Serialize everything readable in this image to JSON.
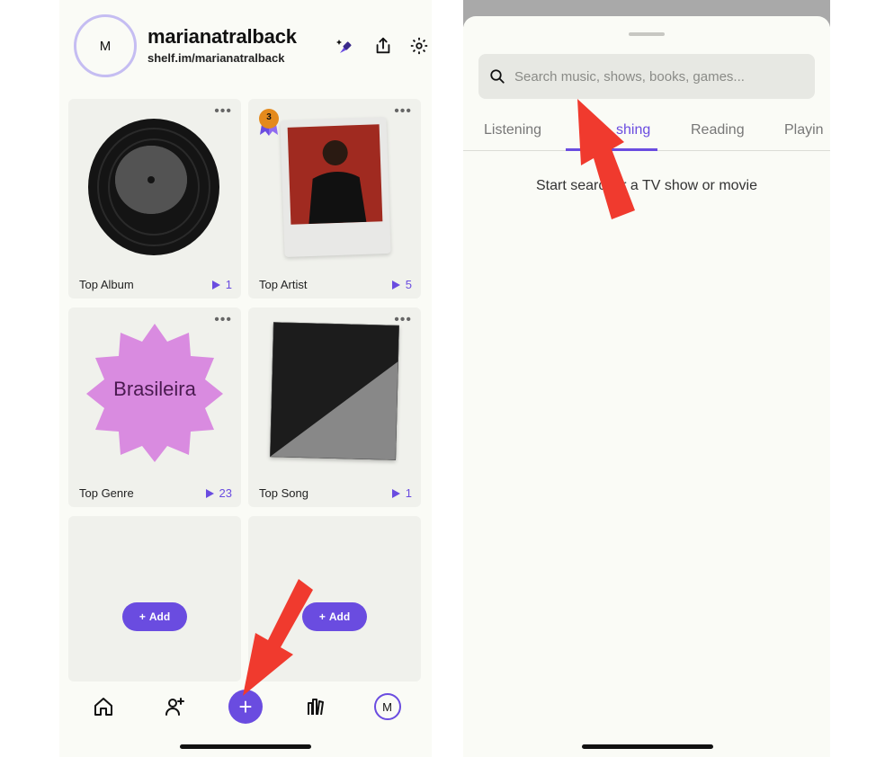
{
  "profile": {
    "avatar_initial": "M",
    "username": "marianatralback",
    "link": "shelf.im/marianatralback"
  },
  "cards": [
    {
      "label": "Top Album",
      "count": "1"
    },
    {
      "label": "Top Artist",
      "count": "5",
      "badge": "3"
    },
    {
      "label": "Top Genre",
      "count": "23",
      "genre_text": "Brasileira"
    },
    {
      "label": "Top Song",
      "count": "1"
    },
    {
      "add_label": "Add"
    },
    {
      "add_label": "Add"
    }
  ],
  "bottom_nav": {
    "avatar_initial": "M",
    "fab_symbol": "+"
  },
  "search": {
    "placeholder": "Search music, shows, books, games...",
    "tabs": [
      "Listening",
      "shing",
      "Reading",
      "Playin"
    ],
    "active_tab_index": 1,
    "empty_message": "Start searc      for a TV show or movie"
  },
  "colors": {
    "accent": "#6a4ce0",
    "arrow": "#f03a2e",
    "genre_star": "#d98be0"
  },
  "icons": [
    "sparkle-brush-icon",
    "share-icon",
    "gear-icon",
    "home-icon",
    "add-friend-icon",
    "plus-icon",
    "library-icon",
    "search-icon",
    "more-dots-icon",
    "play-icon",
    "award-badge-icon"
  ]
}
